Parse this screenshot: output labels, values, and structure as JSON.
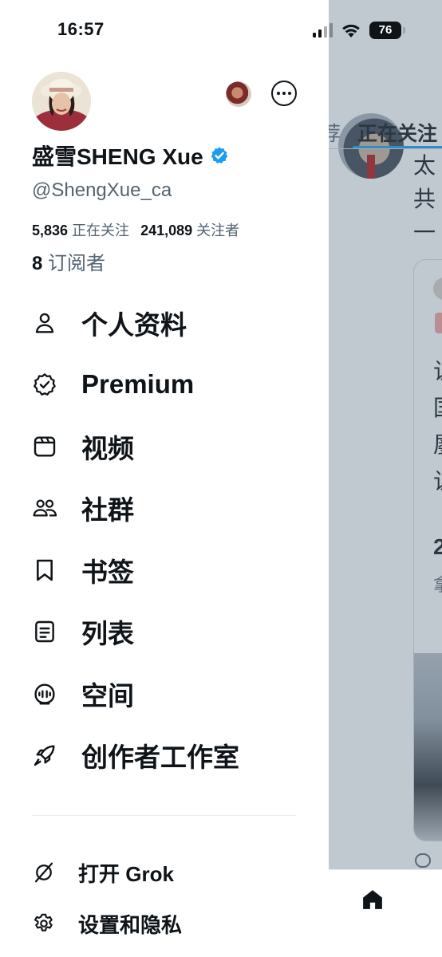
{
  "status_bar": {
    "time": "16:57",
    "battery": "76"
  },
  "profile": {
    "display_name": "盛雪SHENG Xue",
    "handle": "@ShengXue_ca",
    "following_count": "5,836",
    "following_label": "正在关注",
    "followers_count": "241,089",
    "followers_label": "关注者",
    "subscribers_count": "8",
    "subscribers_label": "订阅者",
    "verified_color": "#1d9bf0"
  },
  "menu": {
    "items": [
      {
        "label": "个人资料",
        "icon": "person-icon"
      },
      {
        "label": "Premium",
        "icon": "premium-badge-icon"
      },
      {
        "label": "视频",
        "icon": "video-icon"
      },
      {
        "label": "社群",
        "icon": "communities-icon"
      },
      {
        "label": "书签",
        "icon": "bookmark-icon"
      },
      {
        "label": "列表",
        "icon": "list-icon"
      },
      {
        "label": "空间",
        "icon": "spaces-icon"
      },
      {
        "label": "创作者工作室",
        "icon": "rocket-icon"
      }
    ]
  },
  "settings": {
    "items": [
      {
        "label": "打开 Grok",
        "icon": "grok-icon"
      },
      {
        "label": "设置和隐私",
        "icon": "gear-icon"
      }
    ]
  },
  "background": {
    "tab_previous": "荐",
    "tab_current": "正在关注",
    "post_lines": [
      "太",
      "共",
      "一"
    ],
    "card_lines": [
      "让",
      "国",
      "屡",
      "让"
    ],
    "card_extra": [
      "2",
      "拿"
    ]
  },
  "colors": {
    "accent": "#1d9bf0",
    "text": "#0f1419",
    "secondary": "#536471"
  }
}
